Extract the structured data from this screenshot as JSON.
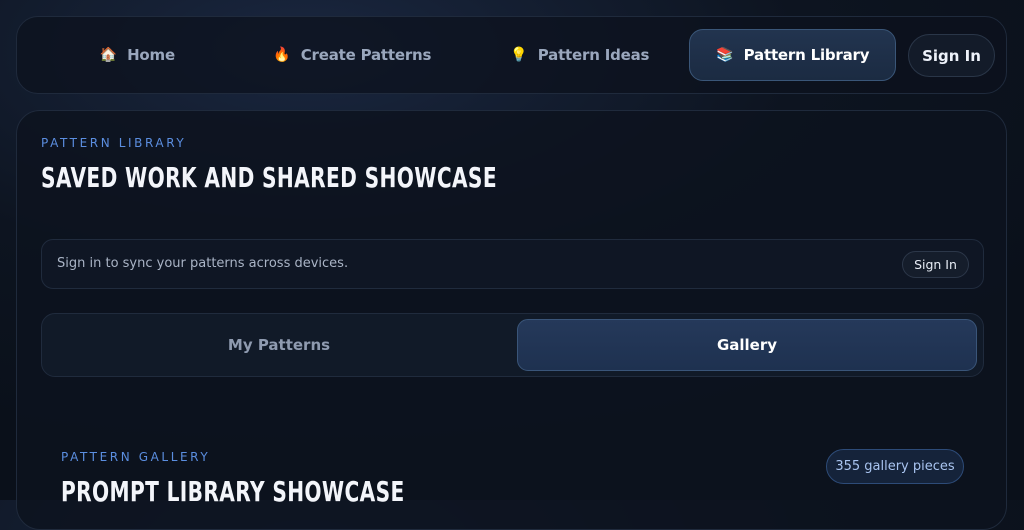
{
  "nav": {
    "items": [
      {
        "label": "Home",
        "icon": "🏠"
      },
      {
        "label": "Create Patterns",
        "icon": "🔥"
      },
      {
        "label": "Pattern Ideas",
        "icon": "💡"
      },
      {
        "label": "Pattern Library",
        "icon": "📚"
      }
    ],
    "signin": "Sign In"
  },
  "library": {
    "eyebrow": "PATTERN LIBRARY",
    "title": "SAVED WORK AND SHARED SHOWCASE",
    "sync_text": "Sign in to sync your patterns across devices.",
    "sync_button": "Sign In",
    "tabs": [
      "My Patterns",
      "Gallery"
    ]
  },
  "gallery": {
    "eyebrow": "PATTERN GALLERY",
    "title": "PROMPT LIBRARY SHOWCASE",
    "count": "355 gallery pieces"
  },
  "colors": {
    "accent": "#5b8ee0",
    "background": "#0d1420"
  }
}
